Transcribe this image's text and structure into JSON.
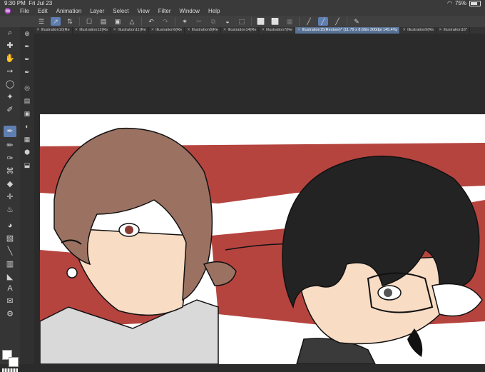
{
  "status": {
    "time": "9:30 PM",
    "date": "Fri Jul 23",
    "battery": "75%",
    "battery_level": 0.75
  },
  "menu": [
    "File",
    "Edit",
    "Animation",
    "Layer",
    "Select",
    "View",
    "Filter",
    "Window",
    "Help"
  ],
  "tabs": [
    {
      "label": "Illustration10(Re",
      "active": false
    },
    {
      "label": "Illustration12(Re",
      "active": false
    },
    {
      "label": "Illustration11(Re",
      "active": false
    },
    {
      "label": "Illustration6(Re",
      "active": false
    },
    {
      "label": "Illustration8(Re",
      "active": false
    },
    {
      "label": "Illustration14(Re",
      "active": false
    },
    {
      "label": "Illustration7(Re",
      "active": false
    },
    {
      "label": "Illustration15(Restore)* (11.79 x 8.66in 300dpi 145.4%)",
      "active": true
    },
    {
      "label": "Illustration9(Re",
      "active": false
    },
    {
      "label": "Illustration16*",
      "active": false
    }
  ],
  "colors": {
    "accent": "#5f7fb2",
    "background_red": "#b5443f",
    "hair_brown": "#9b7262",
    "hair_black": "#232323",
    "skin": "#f9dcc4"
  }
}
